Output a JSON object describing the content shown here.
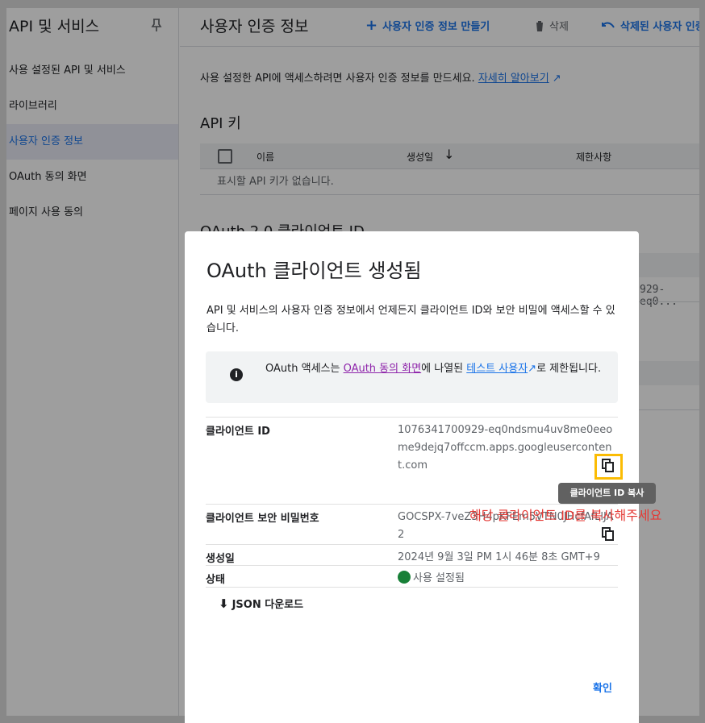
{
  "sidebar": {
    "title": "API 및 서비스",
    "items": [
      {
        "label": "사용 설정된 API 및 서비스"
      },
      {
        "label": "라이브러리"
      },
      {
        "label": "사용자 인증 정보"
      },
      {
        "label": "OAuth 동의 화면"
      },
      {
        "label": "페이지 사용 동의"
      }
    ]
  },
  "topbar": {
    "title": "사용자 인증 정보",
    "create_label": "사용자 인증 정보 만들기",
    "delete_label": "삭제",
    "restore_label": "삭제된 사용자 인증"
  },
  "main": {
    "description": "사용 설정한 API에 액세스하려면 사용자 인증 정보를 만드세요.",
    "learn_more": "자세히 알아보기",
    "api_keys_title": "API 키",
    "columns": [
      "이름",
      "생성일",
      "제한사항"
    ],
    "empty_text": "표시할 API 키가 없습니다.",
    "oauth_title": "OAuth 2.0 클라이언트 ID",
    "oauth_id_fragment": "929-eq0..."
  },
  "dialog": {
    "title": "OAuth 클라이언트 생성됨",
    "description": "API 및 서비스의 사용자 인증 정보에서 언제든지 클라이언트 ID와 보안 비밀에 액세스할 수 있습니다.",
    "info_prefix": "OAuth 액세스는 ",
    "info_link1": "OAuth 동의 화면",
    "info_middle": "에 나열된 ",
    "info_link2": "테스트 사용자",
    "info_suffix": "로 제한됩니다.",
    "client_id_label": "클라이언트 ID",
    "client_id_value": "1076341700929-eq0ndsmu4uv8me0eeome9dejq7offccm.apps.googleusercontent.com",
    "secret_label": "클라이언트 보안 비밀번호",
    "secret_value": "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",
    "created_label": "생성일",
    "created_value": "2024년 9월 3일 PM 1시 46분 8초 GMT+9",
    "status_label": "상태",
    "status_value": "사용 설정됨",
    "json_label": "JSON 다운로드",
    "ok_label": "확인"
  },
  "tooltip": "클라이언트 ID 복사",
  "annotation": "해당 클라이언트 ID를 복사해주세요",
  "colors": {
    "accent": "#1a73e8",
    "highlight": "#fbbc04",
    "annotation": "#e53935",
    "status_ok": "#188038"
  }
}
